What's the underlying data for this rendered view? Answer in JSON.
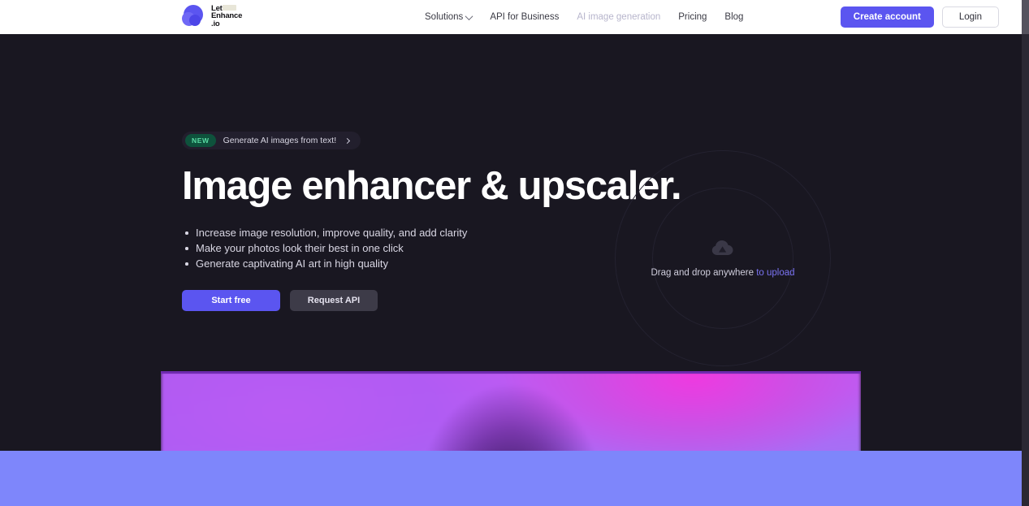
{
  "brand": {
    "name_line1": "Let's",
    "name_line2": "Enhance",
    "name_line3": ".io",
    "logo_icon": "lets-enhance-blob-logo",
    "accent_color": "#5B55F0"
  },
  "header": {
    "nav": [
      {
        "label": "Solutions",
        "has_dropdown": true,
        "muted": false,
        "icon": "chevron-down-icon"
      },
      {
        "label": "API for Business",
        "has_dropdown": false,
        "muted": false
      },
      {
        "label": "AI image generation",
        "has_dropdown": false,
        "muted": true
      },
      {
        "label": "Pricing",
        "has_dropdown": false,
        "muted": false
      },
      {
        "label": "Blog",
        "has_dropdown": false,
        "muted": false
      }
    ],
    "create_account_label": "Create account",
    "login_label": "Login",
    "background_color": "#ffffff"
  },
  "hero": {
    "badge_label": "NEW",
    "badge_text": "Generate AI images from text!",
    "badge_arrow_icon": "chevron-right-icon",
    "badge_bg_color": "#0e523c",
    "badge_text_color": "#59dba3",
    "title": "Image enhancer & upscaler.",
    "bullets": [
      "Increase image resolution, improve quality, and add clarity",
      "Make your photos look their best in one click",
      "Generate captivating AI art in high quality"
    ],
    "primary_button_label": "Start free",
    "secondary_button_label": "Request API",
    "background_color": "#191721"
  },
  "dropzone": {
    "icon": "cloud-upload-icon",
    "text_static": "Drag and drop anywhere",
    "text_link": "to upload",
    "link_color": "#7b74f4"
  },
  "showcase": {
    "image_alt": "blurred purple magenta gradient preview image",
    "dominant_colors": [
      "#c158f2",
      "#ee3ae0",
      "#9b7ef7",
      "#3a1060"
    ]
  },
  "footer_band": {
    "color": "#7e86fb"
  },
  "scrollbar": {
    "position": "right",
    "thumb_color": "#55535e",
    "track_color": "#2a2833"
  }
}
